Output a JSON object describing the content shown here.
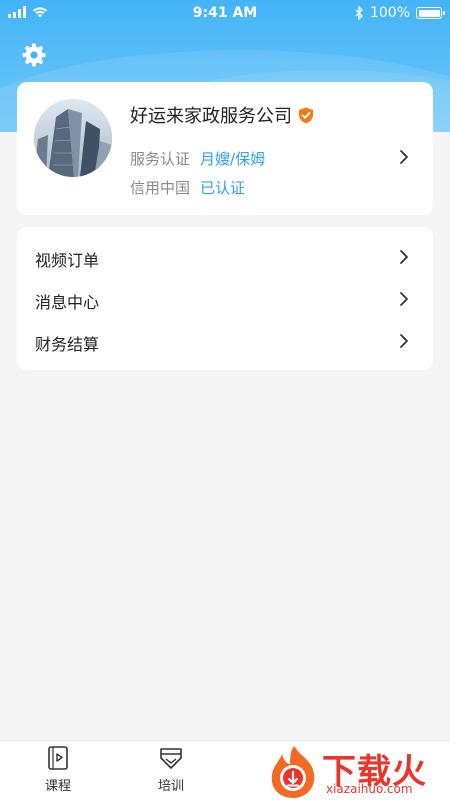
{
  "status_bar": {
    "time": "9:41 AM",
    "battery": "100%"
  },
  "header": {
    "settings_icon": "gear-icon"
  },
  "profile": {
    "company_name": "好运来家政服务公司",
    "verified_icon": "shield-check-icon",
    "service_label": "服务认证",
    "service_value": "月嫂/保姆",
    "credit_label": "信用中国",
    "credit_value": "已认证"
  },
  "menu": {
    "items": [
      {
        "label": "视频订单"
      },
      {
        "label": "消息中心"
      },
      {
        "label": "财务结算"
      }
    ]
  },
  "tab_bar": {
    "tabs": [
      {
        "label": "课程",
        "icon": "course-icon"
      },
      {
        "label": "培训",
        "icon": "training-icon"
      }
    ]
  },
  "watermark": {
    "text": "下载火",
    "sub": "xiazaihuo.com"
  },
  "colors": {
    "header": "#43b4f6",
    "accent": "#2ea1ec",
    "verified": "#f07d1a",
    "watermark": "#e8362c"
  }
}
